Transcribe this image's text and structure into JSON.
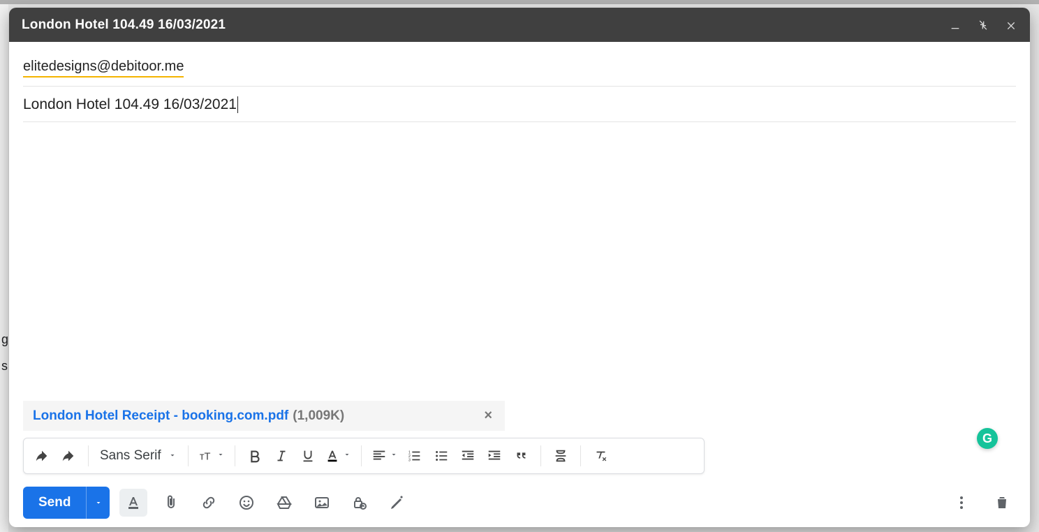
{
  "window": {
    "title": "London Hotel 104.49 16/03/2021"
  },
  "to": {
    "address": "elitedesigns@debitoor.me"
  },
  "subject": {
    "value": "London Hotel 104.49 16/03/2021"
  },
  "attachment": {
    "name": "London Hotel Receipt - booking.com.pdf",
    "size": "(1,009K)"
  },
  "format_toolbar": {
    "font_family": "Sans Serif"
  },
  "actions": {
    "send_label": "Send"
  },
  "grammarly": {
    "glyph": "G"
  }
}
